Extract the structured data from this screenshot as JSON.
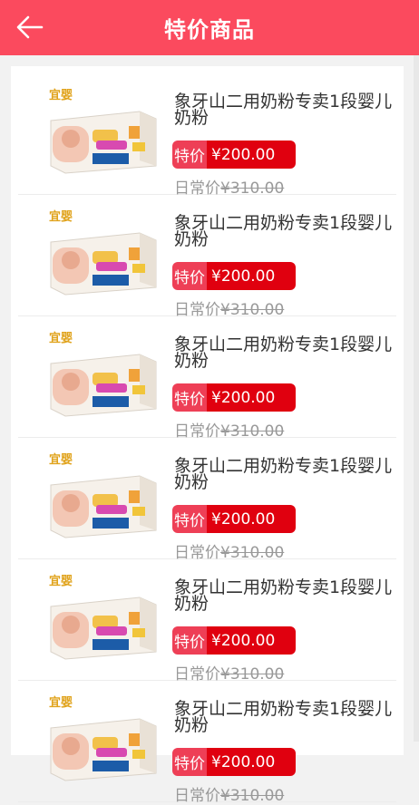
{
  "header": {
    "title": "特价商品",
    "back_icon": "arrow-left-icon",
    "color": "#fb4a5e"
  },
  "colors": {
    "sale_tag": "#ee3f56",
    "price_bg": "#e0000f",
    "muted": "#999999"
  },
  "products": [
    {
      "name": "象牙山二用奶粉专卖1段婴儿奶粉",
      "tag": "特价",
      "price": "¥200.00",
      "orig_label": "日常价",
      "orig_price": "¥310.00"
    },
    {
      "name": "象牙山二用奶粉专卖1段婴儿奶粉",
      "tag": "特价",
      "price": "¥200.00",
      "orig_label": "日常价",
      "orig_price": "¥310.00"
    },
    {
      "name": "象牙山二用奶粉专卖1段婴儿奶粉",
      "tag": "特价",
      "price": "¥200.00",
      "orig_label": "日常价",
      "orig_price": "¥310.00"
    },
    {
      "name": "象牙山二用奶粉专卖1段婴儿奶粉",
      "tag": "特价",
      "price": "¥200.00",
      "orig_label": "日常价",
      "orig_price": "¥310.00"
    },
    {
      "name": "象牙山二用奶粉专卖1段婴儿奶粉",
      "tag": "特价",
      "price": "¥200.00",
      "orig_label": "日常价",
      "orig_price": "¥310.00"
    },
    {
      "name": "象牙山二用奶粉专卖1段婴儿奶粉",
      "tag": "特价",
      "price": "¥200.00",
      "orig_label": "日常价",
      "orig_price": "¥310.00"
    }
  ]
}
